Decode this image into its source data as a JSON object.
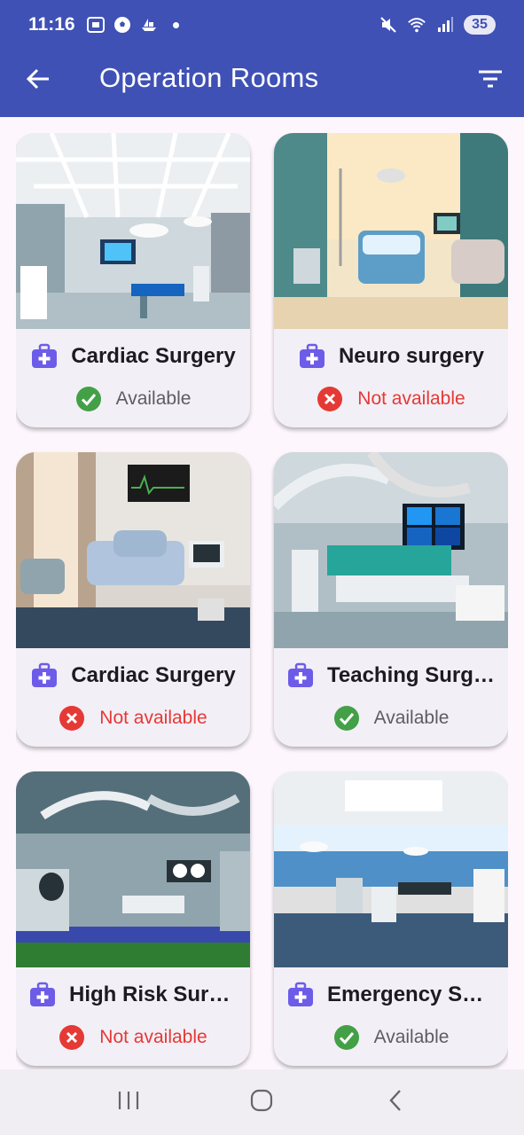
{
  "status_bar": {
    "time": "11:16",
    "battery": "35",
    "icons": [
      "screenshot-icon",
      "soccer-ball-icon",
      "boat-icon",
      "notification-dot",
      "mute-icon",
      "wifi-icon",
      "signal-icon"
    ]
  },
  "app_bar": {
    "title": "Operation Rooms",
    "color": "#3f51b5",
    "back_icon": "arrow-back-icon",
    "filter_icon": "filter-icon"
  },
  "rooms": [
    {
      "name": "Cardiac Surgery",
      "status": "Available",
      "available": true,
      "photo": "operating-room-photo-1"
    },
    {
      "name": "Neuro surgery",
      "status": "Not available",
      "available": false,
      "photo": "operating-room-photo-2"
    },
    {
      "name": "Cardiac Surgery",
      "status": "Not available",
      "available": false,
      "photo": "operating-room-photo-3"
    },
    {
      "name": "Teaching Surgery",
      "status": "Available",
      "available": true,
      "photo": "operating-room-photo-4"
    },
    {
      "name": "High Risk Surgery",
      "status": "Not available",
      "available": false,
      "photo": "operating-room-photo-5"
    },
    {
      "name": "Emergency Surgery",
      "status": "Available",
      "available": true,
      "photo": "operating-room-photo-6"
    }
  ],
  "colors": {
    "available": "#43a047",
    "not_available": "#e53935",
    "kit_icon": "#6c5ce7"
  },
  "nav_bar": {
    "icons": [
      "recents-icon",
      "home-icon",
      "back-icon"
    ]
  }
}
